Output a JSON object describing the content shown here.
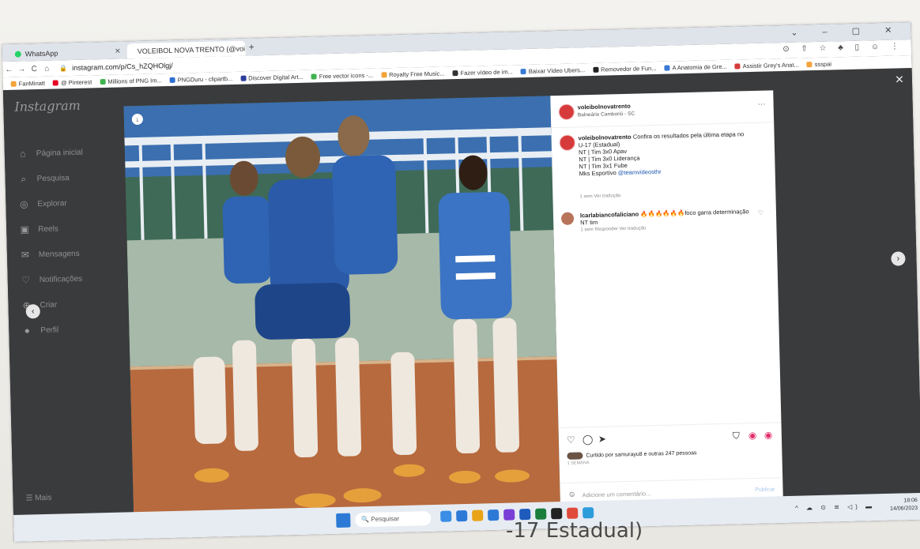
{
  "browser": {
    "tabs": [
      {
        "label": "WhatsApp",
        "color": "#25d366"
      },
      {
        "label": "VOLEIBOL NOVA TRENTO (@voi",
        "color": "#e1306c"
      }
    ],
    "new_tab": "+",
    "window_controls": "⌄ – ▢ ✕",
    "url": "instagram.com/p/Cs_hZQHOlgj/",
    "toolbar_icons": "⊙ ⇧ ☆ ♣ ▯ ☺ ⋮",
    "bookmarks": [
      {
        "label": "FanMinatt",
        "color": "#f2a33a"
      },
      {
        "label": "@ Pinterest",
        "color": "#e60023"
      },
      {
        "label": "Millions of PNG Im...",
        "color": "#3fb34f"
      },
      {
        "label": "PNGDuru - clipartb...",
        "color": "#2f6fd3"
      },
      {
        "label": "Discover Digital Art...",
        "color": "#2c3e99"
      },
      {
        "label": "Free vector icons -...",
        "color": "#3fb34f"
      },
      {
        "label": "Royalty Free Music...",
        "color": "#f2a33a"
      },
      {
        "label": "Fazer vídeo de im...",
        "color": "#333333"
      },
      {
        "label": "Baixar Vídeo Ubers...",
        "color": "#3a7bd5"
      },
      {
        "label": "Removedor de Fun...",
        "color": "#222222"
      },
      {
        "label": "A Anatomia de Gre...",
        "color": "#3a7bd5"
      },
      {
        "label": "Assistir Grey's Anat...",
        "color": "#d63a3a"
      },
      {
        "label": "ssspai",
        "color": "#f2a33a"
      }
    ]
  },
  "instagram": {
    "logo": "Instagram",
    "nav": [
      {
        "label": "Página inicial",
        "icon": "⌂"
      },
      {
        "label": "Pesquisa",
        "icon": "⌕"
      },
      {
        "label": "Explorar",
        "icon": "◎"
      },
      {
        "label": "Reels",
        "icon": "▣"
      },
      {
        "label": "Mensagens",
        "icon": "✉"
      },
      {
        "label": "Notificações",
        "icon": "♡"
      },
      {
        "label": "Criar",
        "icon": "⊕"
      },
      {
        "label": "Perfil",
        "icon": "●"
      }
    ],
    "more": "☰  Mais"
  },
  "post": {
    "username": "voleibolnovatrento",
    "location": "Balneário Camboriú - SC",
    "more_menu": "···",
    "caption": {
      "username": "voleibolnovatrento",
      "intro": "Confira os resultados pela última etapa no",
      "lines": [
        "U-17 (Estadual)",
        "NT | Tim 3x0 Apav",
        "NT | Tim 3x0 Liderança",
        "NT | Tim 3x1 Fube"
      ],
      "credit_prefix": "Mks Esportivo ",
      "credit_mention": "@teamvideosthr",
      "meta": "1 sem   Ver tradução"
    },
    "comment": {
      "username": "lcarlabiancofaliciano",
      "text": "🔥🔥🔥🔥🔥🔥foco garra determinação NT tim",
      "meta": "1 sem   Responder   Ver tradução"
    },
    "likes": "Curtido por samurayu8 e outras 247 pessoas",
    "time": "1 SEMANA",
    "add_comment_placeholder": "Adicione um comentário...",
    "post_button": "Publicar"
  },
  "taskbar": {
    "search": "Pesquisar",
    "tray": "^ ☁ ⊙ ≋ ◁) ▬",
    "clock_time": "18:06",
    "clock_date": "14/06/2023",
    "apps": [
      "#3a8ee6",
      "#2d7ad6",
      "#e8a317",
      "#2d7ad6",
      "#7a3fd6",
      "#1e5bbd",
      "#1b7d3c",
      "#222222",
      "#e04a3a",
      "#2d9cdb"
    ]
  },
  "handwriting": "-17 Estadual)"
}
